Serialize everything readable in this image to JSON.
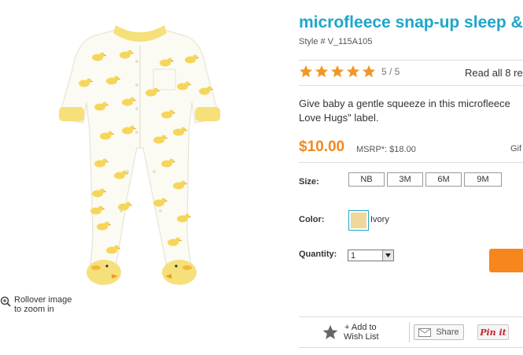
{
  "image": {
    "alt": "microfleece snap-up sleep & play",
    "zoom_hint": "Rollover image to zoom in",
    "zoom_hint_lines": [
      "Rollover image",
      "to zoom in"
    ]
  },
  "product": {
    "title": "microfleece snap-up sleep &",
    "style": "Style # V_115A105",
    "rating": {
      "stars_filled": 5,
      "score_text": "5 / 5",
      "reviews_link": "Read all 8 re"
    },
    "description_lines": [
      "Give baby a gentle squeeze in this microfleece",
      "Love Hugs\" label."
    ],
    "price": "$10.00",
    "msrp": "MSRP*: $18.00",
    "gift_link": "Gif"
  },
  "options": {
    "size_label": "Size:",
    "sizes": [
      "NB",
      "3M",
      "6M",
      "9M"
    ],
    "color_label": "Color:",
    "color_name": "Ivory",
    "color_swatch": "#f2d79a",
    "quantity_label": "Quantity:",
    "quantity_value": "1"
  },
  "actions": {
    "wishlist": "+ Add to Wish List",
    "wishlist_lines": [
      "+ Add to",
      "Wish List"
    ],
    "share": "Share",
    "pinit": "Pin it"
  },
  "colors": {
    "accent_title": "#1fa6c9",
    "price": "#ef8a1f",
    "star": "#f0962a",
    "add_to_bag": "#f7861c"
  },
  "icons": [
    "zoom-icon",
    "star-icon",
    "wishlist-star-icon",
    "envelope-icon",
    "dropdown-arrow-icon"
  ]
}
